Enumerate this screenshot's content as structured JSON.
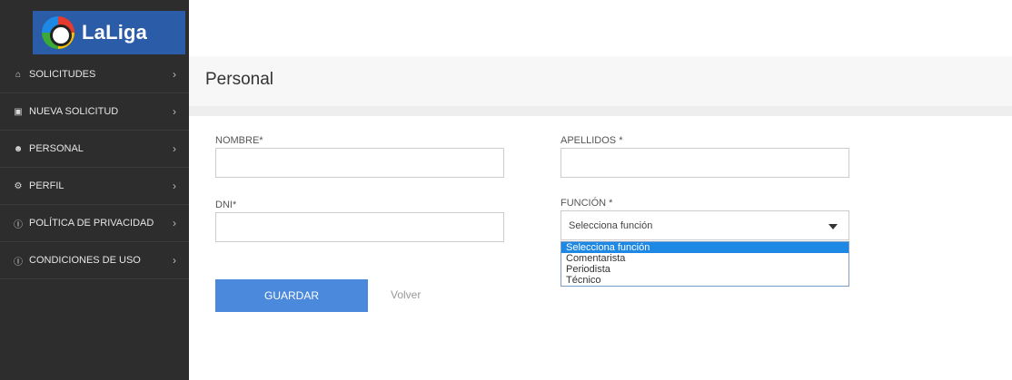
{
  "brand": {
    "name": "LaLiga"
  },
  "sidebar": {
    "items": [
      {
        "label": "SOLICITUDES",
        "icon": "home-icon"
      },
      {
        "label": "NUEVA SOLICITUD",
        "icon": "briefcase-icon"
      },
      {
        "label": "PERSONAL",
        "icon": "user-plus-icon"
      },
      {
        "label": "PERFIL",
        "icon": "cogs-icon"
      },
      {
        "label": "POLÍTICA DE PRIVACIDAD",
        "icon": "info-icon"
      },
      {
        "label": "CONDICIONES DE USO",
        "icon": "info-icon"
      }
    ]
  },
  "header": {
    "title": "Personal"
  },
  "form": {
    "nombre": {
      "label": "NOMBRE*",
      "value": ""
    },
    "apellidos": {
      "label": "APELLIDOS *",
      "value": ""
    },
    "dni": {
      "label": "DNI*",
      "value": ""
    },
    "funcion": {
      "label": "FUNCIÓN *",
      "selected": "Selecciona función",
      "options": [
        "Selecciona función",
        "Comentarista",
        "Periodista",
        "Técnico"
      ]
    },
    "save_label": "GUARDAR",
    "back_label": "Volver"
  },
  "colors": {
    "sidebar_bg": "#2d2d2d",
    "brand_blue": "#2a5ca8",
    "button_blue": "#4a89dc",
    "highlight": "#1e88e5"
  }
}
